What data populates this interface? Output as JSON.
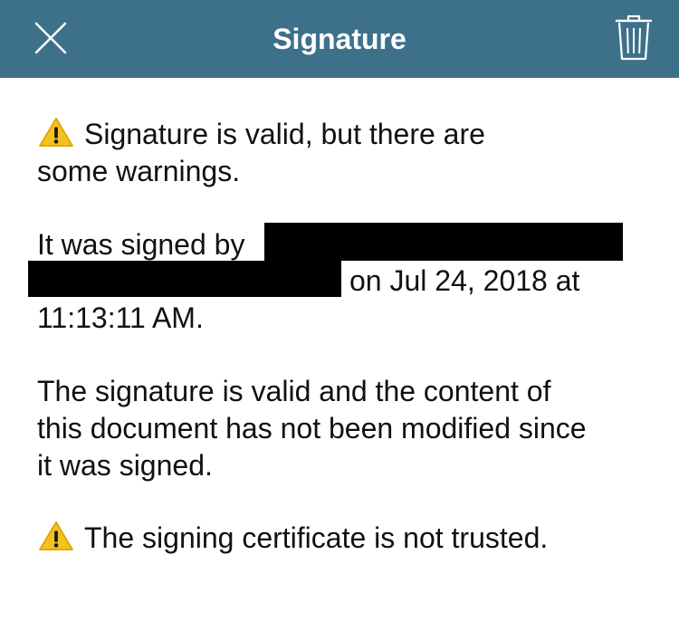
{
  "header": {
    "title": "Signature",
    "close_icon": "close-icon",
    "trash_icon": "trash-icon",
    "background_color": "#3d718a"
  },
  "status": {
    "warning_icon": "warning-icon",
    "line1": "Signature is valid, but there are",
    "line2": "some warnings."
  },
  "signer": {
    "line1": "It was signed by",
    "line2": "on Jul 24, 2018 at",
    "line3": "11:13:11 AM."
  },
  "validity": {
    "line1": "The signature is valid and the content of",
    "line2": "this document has not been modified since",
    "line3": "it was signed."
  },
  "certificate": {
    "warning_icon": "warning-icon",
    "text": "The signing certificate is not trusted."
  }
}
